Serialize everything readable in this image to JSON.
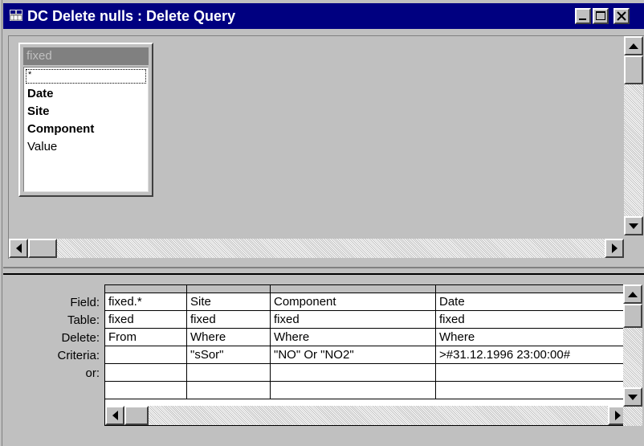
{
  "window": {
    "title": "DC Delete nulls : Delete Query"
  },
  "field_list": {
    "table_name": "fixed",
    "items": [
      {
        "label": "*",
        "bold": false
      },
      {
        "label": "Date",
        "bold": true
      },
      {
        "label": "Site",
        "bold": true
      },
      {
        "label": "Component",
        "bold": true
      },
      {
        "label": "Value",
        "bold": false
      }
    ]
  },
  "grid": {
    "row_labels": [
      "Field:",
      "Table:",
      "Delete:",
      "Criteria:",
      "or:"
    ],
    "columns": [
      {
        "field": "fixed.*",
        "table": "fixed",
        "delete": "From",
        "criteria": "",
        "or": ""
      },
      {
        "field": "Site",
        "table": "fixed",
        "delete": "Where",
        "criteria": "\"sSor\"",
        "or": ""
      },
      {
        "field": "Component",
        "table": "fixed",
        "delete": "Where",
        "criteria": "\"NO\" Or \"NO2\"",
        "or": ""
      },
      {
        "field": "Date",
        "table": "fixed",
        "delete": "Where",
        "criteria": ">#31.12.1996 23:00:00#",
        "or": ""
      }
    ]
  },
  "colors": {
    "titlebar": "#000080",
    "face": "#c0c0c0"
  }
}
